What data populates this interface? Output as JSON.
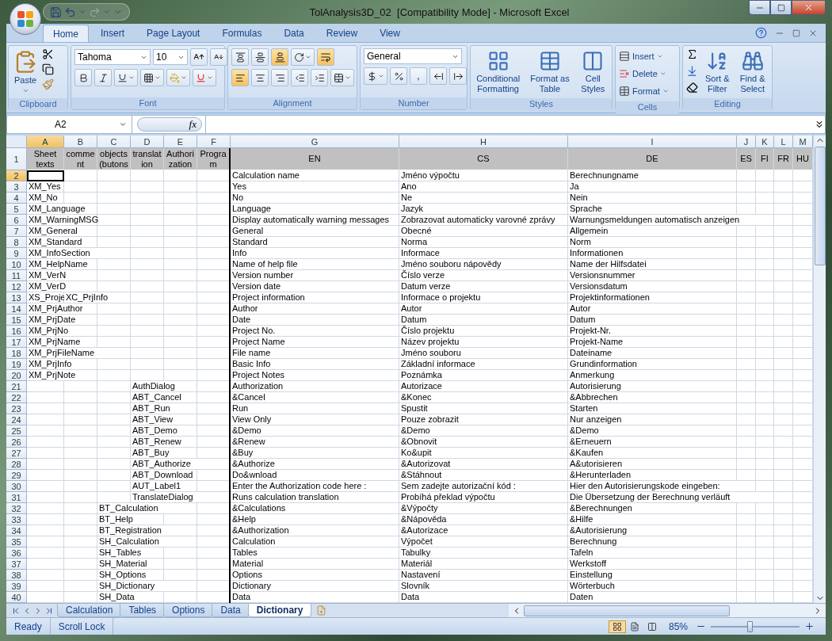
{
  "window": {
    "title": "TolAnalysis3D_02  [Compatibility Mode] - Microsoft Excel"
  },
  "ribbon_tabs": [
    {
      "label": "Home",
      "selected": true
    },
    {
      "label": "Insert",
      "selected": false
    },
    {
      "label": "Page Layout",
      "selected": false
    },
    {
      "label": "Formulas",
      "selected": false
    },
    {
      "label": "Data",
      "selected": false
    },
    {
      "label": "Review",
      "selected": false
    },
    {
      "label": "View",
      "selected": false
    }
  ],
  "clipboard": {
    "title": "Clipboard",
    "paste": "Paste"
  },
  "font": {
    "title": "Font",
    "family": "Tahoma",
    "size": "10"
  },
  "alignment": {
    "title": "Alignment",
    "vertical": [
      {
        "on": false
      },
      {
        "on": false
      },
      {
        "on": true
      }
    ],
    "horizontal": [
      {
        "on": true
      },
      {
        "on": false
      },
      {
        "on": false
      }
    ],
    "wrap_text": {
      "on": true
    }
  },
  "number": {
    "title": "Number",
    "format": "General",
    "comma": ","
  },
  "styles": {
    "title": "Styles",
    "buttons": [
      "Conditional Formatting",
      "Format as Table",
      "Cell Styles"
    ]
  },
  "cells": {
    "title": "Cells",
    "buttons": [
      "Insert",
      "Delete",
      "Format"
    ]
  },
  "editing": {
    "title": "Editing",
    "buttons": [
      "Sort & Filter",
      "Find & Select"
    ]
  },
  "formula_bar": {
    "name_box": "A2",
    "function_label": "fx"
  },
  "sheet": {
    "columns": [
      {
        "letter": "A",
        "selected": true
      },
      {
        "letter": "B",
        "selected": false
      },
      {
        "letter": "C",
        "selected": false
      },
      {
        "letter": "D",
        "selected": false
      },
      {
        "letter": "E",
        "selected": false
      },
      {
        "letter": "F",
        "selected": false
      },
      {
        "letter": "G",
        "selected": false
      },
      {
        "letter": "H",
        "selected": false
      },
      {
        "letter": "I",
        "selected": false
      },
      {
        "letter": "J",
        "selected": false
      },
      {
        "letter": "K",
        "selected": false
      },
      {
        "letter": "L",
        "selected": false
      },
      {
        "letter": "M",
        "selected": false
      }
    ],
    "header_row": {
      "number": "1",
      "cells": [
        "Sheet texts",
        "comment",
        "objects (butons",
        "translation",
        "Authorization",
        "Program",
        "EN",
        "CS",
        "DE",
        "ES",
        "FI",
        "FR",
        "HU"
      ]
    },
    "rows": [
      {
        "number": "2",
        "selected": true,
        "cells": [
          null,
          null,
          null,
          null,
          null,
          null,
          "Calculation name",
          "Jméno výpočtu",
          "Berechnungname",
          null,
          null,
          null,
          null
        ]
      },
      {
        "number": "3",
        "selected": false,
        "cells": [
          "XM_Yes",
          null,
          null,
          null,
          null,
          null,
          "Yes",
          "Ano",
          "Ja",
          null,
          null,
          null,
          null
        ]
      },
      {
        "number": "4",
        "selected": false,
        "cells": [
          "XM_No",
          null,
          null,
          null,
          null,
          null,
          "No",
          "Ne",
          "Nein",
          null,
          null,
          null,
          null
        ]
      },
      {
        "number": "5",
        "selected": false,
        "cells": [
          "XM_Language",
          null,
          null,
          null,
          null,
          null,
          "Language",
          "Jazyk",
          "Sprache",
          null,
          null,
          null,
          null
        ]
      },
      {
        "number": "6",
        "selected": false,
        "cells": [
          "XM_WarningMSG",
          null,
          null,
          null,
          null,
          null,
          "Display automatically warning messages",
          "Zobrazovat automaticky varovné zprávy",
          "Warnungsmeldungen automatisch anzeigen",
          null,
          null,
          null,
          null
        ]
      },
      {
        "number": "7",
        "selected": false,
        "cells": [
          "XM_General",
          null,
          null,
          null,
          null,
          null,
          "General",
          "Obecné",
          "Allgemein",
          null,
          null,
          null,
          null
        ]
      },
      {
        "number": "8",
        "selected": false,
        "cells": [
          "XM_Standard",
          null,
          null,
          null,
          null,
          null,
          "Standard",
          "Norma",
          "Norm",
          null,
          null,
          null,
          null
        ]
      },
      {
        "number": "9",
        "selected": false,
        "cells": [
          "XM_InfoSection",
          null,
          null,
          null,
          null,
          null,
          "Info",
          "Informace",
          "Informationen",
          null,
          null,
          null,
          null
        ]
      },
      {
        "number": "10",
        "selected": false,
        "cells": [
          "XM_HelpName",
          null,
          null,
          null,
          null,
          null,
          "Name of help file",
          "Jméno souboru nápovědy",
          "Name der Hilfsdatei",
          null,
          null,
          null,
          null
        ]
      },
      {
        "number": "11",
        "selected": false,
        "cells": [
          "XM_VerN",
          null,
          null,
          null,
          null,
          null,
          "Version number",
          "Číslo verze",
          "Versionsnummer",
          null,
          null,
          null,
          null
        ]
      },
      {
        "number": "12",
        "selected": false,
        "cells": [
          "XM_VerD",
          null,
          null,
          null,
          null,
          null,
          "Version date",
          "Datum verze",
          "Versionsdatum",
          null,
          null,
          null,
          null
        ]
      },
      {
        "number": "13",
        "selected": false,
        "cells": [
          "XS_Proje",
          "XC_PrjInfo",
          null,
          null,
          null,
          null,
          "Project information",
          "Informace o projektu",
          "Projektinformationen",
          null,
          null,
          null,
          null
        ]
      },
      {
        "number": "14",
        "selected": false,
        "cells": [
          "XM_PrjAuthor",
          null,
          null,
          null,
          null,
          null,
          "Author",
          "Autor",
          "Autor",
          null,
          null,
          null,
          null
        ]
      },
      {
        "number": "15",
        "selected": false,
        "cells": [
          "XM_PrjDate",
          null,
          null,
          null,
          null,
          null,
          "Date",
          "Datum",
          "Datum",
          null,
          null,
          null,
          null
        ]
      },
      {
        "number": "16",
        "selected": false,
        "cells": [
          "XM_PrjNo",
          null,
          null,
          null,
          null,
          null,
          "Project No.",
          "Číslo projektu",
          "Projekt-Nr.",
          null,
          null,
          null,
          null
        ]
      },
      {
        "number": "17",
        "selected": false,
        "cells": [
          "XM_PrjName",
          null,
          null,
          null,
          null,
          null,
          "Project Name",
          "Název projektu",
          "Projekt-Name",
          null,
          null,
          null,
          null
        ]
      },
      {
        "number": "18",
        "selected": false,
        "cells": [
          "XM_PrjFileName",
          null,
          null,
          null,
          null,
          null,
          "File name",
          "Jméno souboru",
          "Dateiname",
          null,
          null,
          null,
          null
        ]
      },
      {
        "number": "19",
        "selected": false,
        "cells": [
          "XM_PrjInfo",
          null,
          null,
          null,
          null,
          null,
          "Basic Info",
          "Základní informace",
          "Grundinformation",
          null,
          null,
          null,
          null
        ]
      },
      {
        "number": "20",
        "selected": false,
        "cells": [
          "XM_PrjNote",
          null,
          null,
          null,
          null,
          null,
          "Project Notes",
          "Poznámka",
          "Anmerkung",
          null,
          null,
          null,
          null
        ]
      },
      {
        "number": "21",
        "selected": false,
        "cells": [
          null,
          null,
          null,
          "AuthDialog",
          null,
          null,
          "Authorization",
          "Autorizace",
          "Autorisierung",
          null,
          null,
          null,
          null
        ]
      },
      {
        "number": "22",
        "selected": false,
        "cells": [
          null,
          null,
          null,
          "ABT_Cancel",
          null,
          null,
          "&Cancel",
          "&Konec",
          "&Abbrechen",
          null,
          null,
          null,
          null
        ]
      },
      {
        "number": "23",
        "selected": false,
        "cells": [
          null,
          null,
          null,
          "ABT_Run",
          null,
          null,
          "Run",
          "Spustit",
          "Starten",
          null,
          null,
          null,
          null
        ]
      },
      {
        "number": "24",
        "selected": false,
        "cells": [
          null,
          null,
          null,
          "ABT_View",
          null,
          null,
          "View Only",
          "Pouze zobrazit",
          "Nur anzeigen",
          null,
          null,
          null,
          null
        ]
      },
      {
        "number": "25",
        "selected": false,
        "cells": [
          null,
          null,
          null,
          "ABT_Demo",
          null,
          null,
          "&Demo",
          "&Demo",
          "&Demo",
          null,
          null,
          null,
          null
        ]
      },
      {
        "number": "26",
        "selected": false,
        "cells": [
          null,
          null,
          null,
          "ABT_Renew",
          null,
          null,
          "&Renew",
          "&Obnovit",
          "&Erneuern",
          null,
          null,
          null,
          null
        ]
      },
      {
        "number": "27",
        "selected": false,
        "cells": [
          null,
          null,
          null,
          "ABT_Buy",
          null,
          null,
          "&Buy",
          "Ko&upit",
          "&Kaufen",
          null,
          null,
          null,
          null
        ]
      },
      {
        "number": "28",
        "selected": false,
        "cells": [
          null,
          null,
          null,
          "ABT_Authorize",
          null,
          null,
          "&Authorize",
          "&Autorizovat",
          "A&utorisieren",
          null,
          null,
          null,
          null
        ]
      },
      {
        "number": "29",
        "selected": false,
        "cells": [
          null,
          null,
          null,
          "ABT_Download",
          null,
          null,
          "Do&wnload",
          "&Stáhnout",
          "&Herunterladen",
          null,
          null,
          null,
          null
        ]
      },
      {
        "number": "30",
        "selected": false,
        "cells": [
          null,
          null,
          null,
          "AUT_Label1",
          null,
          null,
          "Enter the Authorization code here :",
          "Sem zadejte autorizační kód :",
          "Hier den Autorisierungskode eingeben:",
          null,
          null,
          null,
          null
        ]
      },
      {
        "number": "31",
        "selected": false,
        "cells": [
          null,
          null,
          null,
          "TranslateDialog",
          null,
          null,
          "Runs calculation translation",
          "Probíhá překlad výpočtu",
          "Die Übersetzung der Berechnung verläuft",
          null,
          null,
          null,
          null
        ]
      },
      {
        "number": "32",
        "selected": false,
        "cells": [
          null,
          null,
          "BT_Calculation",
          null,
          null,
          null,
          "&Calculations",
          "&Výpočty",
          "&Berechnungen",
          null,
          null,
          null,
          null
        ]
      },
      {
        "number": "33",
        "selected": false,
        "cells": [
          null,
          null,
          "BT_Help",
          null,
          null,
          null,
          "&Help",
          "&Nápověda",
          "&Hilfe",
          null,
          null,
          null,
          null
        ]
      },
      {
        "number": "34",
        "selected": false,
        "cells": [
          null,
          null,
          "BT_Registration",
          null,
          null,
          null,
          "&Authorization",
          "&Autorizace",
          "&Autorisierung",
          null,
          null,
          null,
          null
        ]
      },
      {
        "number": "35",
        "selected": false,
        "cells": [
          null,
          null,
          "SH_Calculation",
          null,
          null,
          null,
          "Calculation",
          "Výpočet",
          "Berechnung",
          null,
          null,
          null,
          null
        ]
      },
      {
        "number": "36",
        "selected": false,
        "cells": [
          null,
          null,
          "SH_Tables",
          null,
          null,
          null,
          "Tables",
          "Tabulky",
          "Tafeln",
          null,
          null,
          null,
          null
        ]
      },
      {
        "number": "37",
        "selected": false,
        "cells": [
          null,
          null,
          "SH_Material",
          null,
          null,
          null,
          "Material",
          "Materiál",
          "Werkstoff",
          null,
          null,
          null,
          null
        ]
      },
      {
        "number": "38",
        "selected": false,
        "cells": [
          null,
          null,
          "SH_Options",
          null,
          null,
          null,
          "Options",
          "Nastavení",
          "Einstellung",
          null,
          null,
          null,
          null
        ]
      },
      {
        "number": "39",
        "selected": false,
        "cells": [
          null,
          null,
          "SH_Dictionary",
          null,
          null,
          null,
          "Dictionary",
          "Slovník",
          "Wörterbuch",
          null,
          null,
          null,
          null
        ]
      },
      {
        "number": "40",
        "selected": false,
        "cells": [
          null,
          null,
          "SH_Data",
          null,
          null,
          null,
          "Data",
          "Data",
          "Daten",
          null,
          null,
          null,
          null
        ]
      }
    ]
  },
  "sheet_tabs": [
    {
      "label": "Calculation",
      "selected": false
    },
    {
      "label": "Tables",
      "selected": false
    },
    {
      "label": "Options",
      "selected": false
    },
    {
      "label": "Data",
      "selected": false
    },
    {
      "label": "Dictionary",
      "selected": true
    }
  ],
  "status_bar": {
    "items": [
      "Ready",
      "Scroll Lock"
    ],
    "views": [
      {
        "selected": true
      },
      {
        "selected": false
      },
      {
        "selected": false
      }
    ],
    "zoom": "85%",
    "zoom_slider": {
      "level": 0.44
    }
  }
}
